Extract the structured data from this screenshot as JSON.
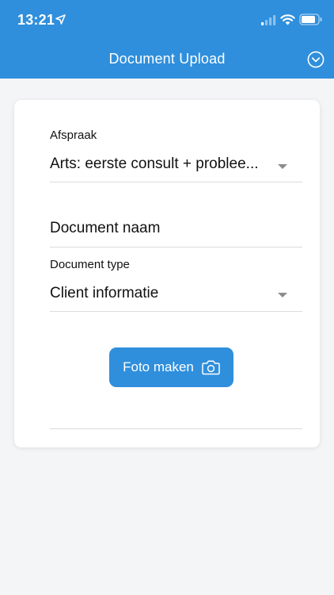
{
  "status_bar": {
    "time": "13:21"
  },
  "header": {
    "title": "Document Upload",
    "menu_icon": "chevron-down-circle-icon",
    "background_color": "#2f8fdc"
  },
  "form": {
    "afspraak": {
      "label": "Afspraak",
      "value": "Arts: eerste consult + problee..."
    },
    "document_naam": {
      "placeholder": "Document naam",
      "value": ""
    },
    "document_type": {
      "label": "Document type",
      "value": "Client informatie"
    },
    "photo_button": {
      "label": "Foto maken",
      "icon": "camera-icon"
    }
  }
}
